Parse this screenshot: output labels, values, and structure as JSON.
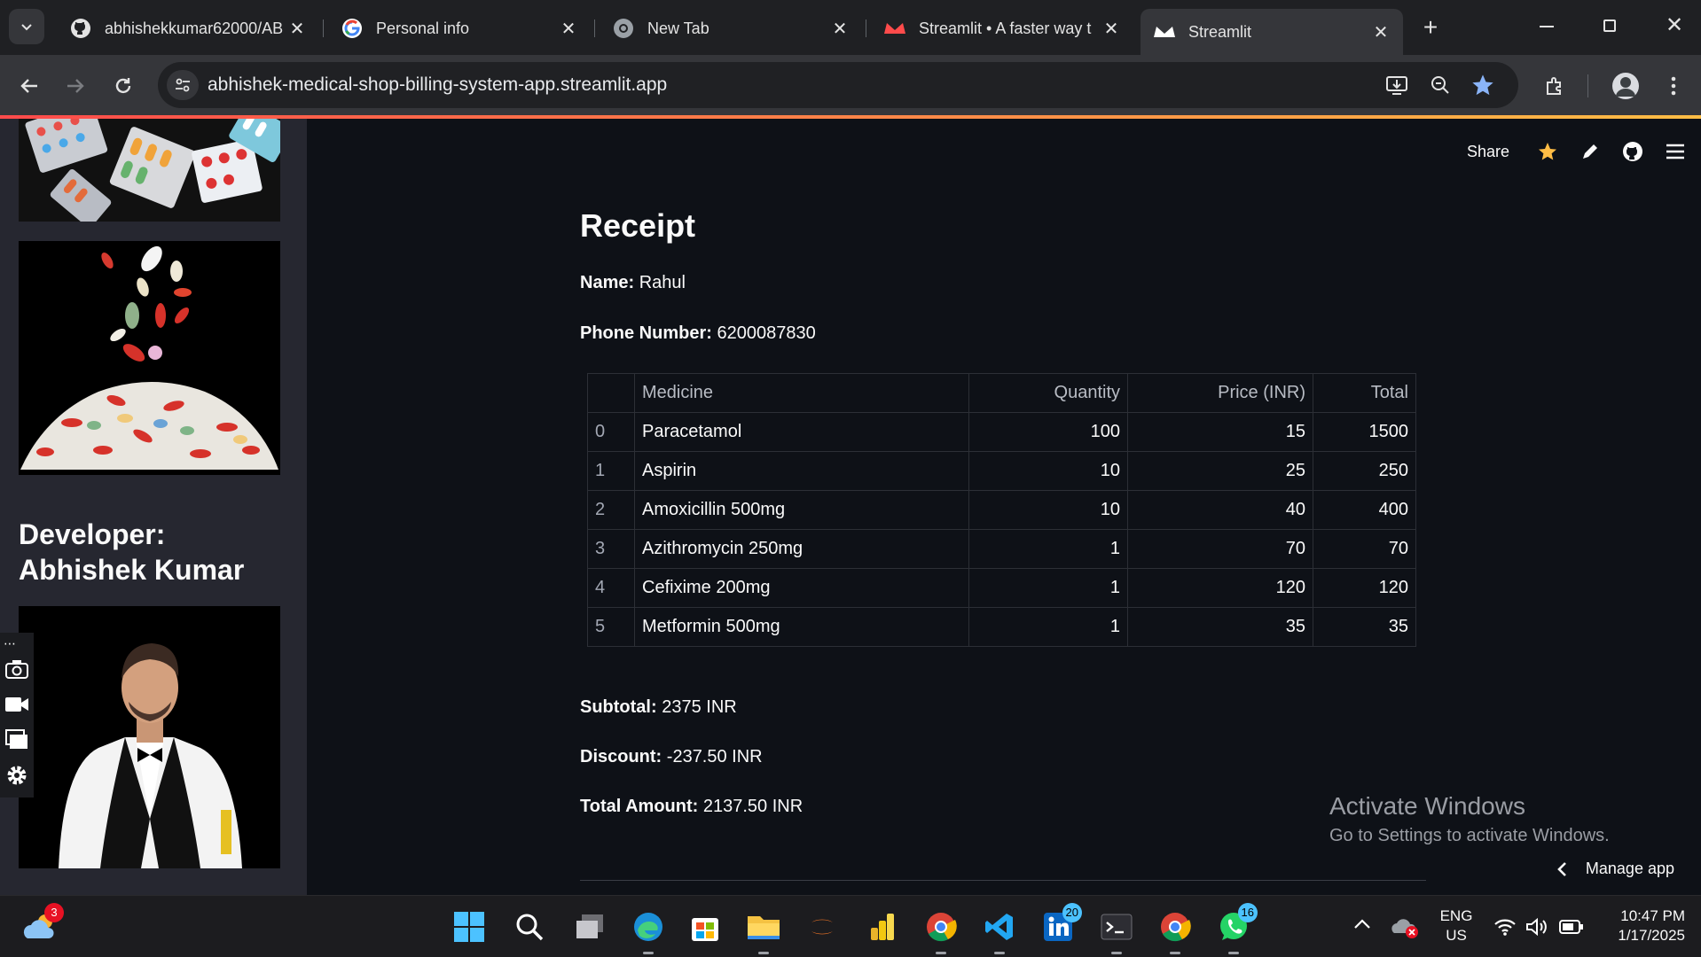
{
  "browser": {
    "tabs": [
      {
        "title": "abhishekkumar62000/AB",
        "icon": "github-icon"
      },
      {
        "title": "Personal info",
        "icon": "google-icon"
      },
      {
        "title": "New Tab",
        "icon": "chrome-icon"
      },
      {
        "title": "Streamlit • A faster way t",
        "icon": "streamlit-icon"
      },
      {
        "title": "Streamlit",
        "icon": "streamlit-icon"
      }
    ],
    "url": "abhishek-medical-shop-billing-system-app.streamlit.app"
  },
  "sidebar": {
    "developer_heading": "Developer: Abhishek Kumar"
  },
  "header": {
    "share_label": "Share"
  },
  "receipt": {
    "title": "Receipt",
    "name_label": "Name:",
    "name_value": "Rahul",
    "phone_label": "Phone Number:",
    "phone_value": "6200087830",
    "columns": [
      "",
      "Medicine",
      "Quantity",
      "Price (INR)",
      "Total"
    ],
    "rows": [
      {
        "idx": "0",
        "medicine": "Paracetamol",
        "qty": "100",
        "price": "15",
        "total": "1500"
      },
      {
        "idx": "1",
        "medicine": "Aspirin",
        "qty": "10",
        "price": "25",
        "total": "250"
      },
      {
        "idx": "2",
        "medicine": "Amoxicillin 500mg",
        "qty": "10",
        "price": "40",
        "total": "400"
      },
      {
        "idx": "3",
        "medicine": "Azithromycin 250mg",
        "qty": "1",
        "price": "70",
        "total": "70"
      },
      {
        "idx": "4",
        "medicine": "Cefixime 200mg",
        "qty": "1",
        "price": "120",
        "total": "120"
      },
      {
        "idx": "5",
        "medicine": "Metformin 500mg",
        "qty": "1",
        "price": "35",
        "total": "35"
      }
    ],
    "subtotal_label": "Subtotal:",
    "subtotal_value": "2375 INR",
    "discount_label": "Discount:",
    "discount_value": "-237.50 INR",
    "total_label": "Total Amount:",
    "total_value": "2137.50 INR"
  },
  "watermark": {
    "line1": "Activate Windows",
    "line2": "Go to Settings to activate Windows."
  },
  "manage_app_label": "Manage app",
  "taskbar": {
    "weather_badge": "3",
    "linkedin_badge": "20",
    "whatsapp_badge": "16",
    "lang_line1": "ENG",
    "lang_line2": "US",
    "time": "10:47 PM",
    "date": "1/17/2025"
  },
  "colors": {
    "app_bg": "#0e1117",
    "sidebar_bg": "#262730",
    "accent_red": "#ff4b4b",
    "accent_yellow": "#ffbd45"
  }
}
